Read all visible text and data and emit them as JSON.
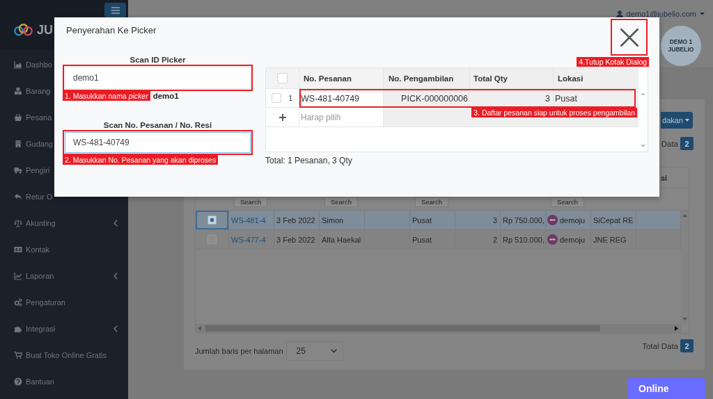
{
  "sidebar": {
    "brand": "JU",
    "items": [
      {
        "label": "Dashbo",
        "expandable": false
      },
      {
        "label": "Barang",
        "expandable": false
      },
      {
        "label": "Pesana",
        "expandable": false
      },
      {
        "label": "Gudang",
        "expandable": false
      },
      {
        "label": "Pengiri",
        "expandable": false
      },
      {
        "label": "Retur O",
        "expandable": false
      },
      {
        "label": "Akunting",
        "expandable": true
      },
      {
        "label": "Kontak",
        "expandable": false
      },
      {
        "label": "Laporan",
        "expandable": true
      },
      {
        "label": "Pengaturan",
        "expandable": false
      },
      {
        "label": "Integrasi",
        "expandable": true
      },
      {
        "label": "Buat Toko Online Gratis",
        "expandable": false
      },
      {
        "label": "Bantuan",
        "expandable": false
      }
    ]
  },
  "top_bar": {
    "user_email": "demo1@jubelio.com",
    "avatar_lines": [
      "DEMO 1",
      "JUBELIO"
    ]
  },
  "page": {
    "action_button": "dakan",
    "total": {
      "label": "Data",
      "count": "2"
    },
    "table": {
      "column_10_heading": "si",
      "filter_buttons": [
        "Search",
        "Search",
        "Search",
        "Search"
      ],
      "rows": [
        {
          "selected": true,
          "order_no": "WS-481-4",
          "date": "3 Feb 2022",
          "customer": "Simon",
          "location": "Pusat",
          "qty": "3",
          "amount": "Rp 750.000,",
          "channel": "demoju",
          "courier": "SiCepat RE"
        },
        {
          "selected": false,
          "order_no": "WS-477-4",
          "date": "3 Feb 2022",
          "customer": "Alfa Haekal",
          "location": "Pusat",
          "qty": "2",
          "amount": "Rp 510.000,",
          "channel": "demoju",
          "courier": "JNE REG"
        }
      ]
    },
    "footer": {
      "page_size_label": "Jumlah baris per halaman",
      "page_size": "25",
      "total_label": "Total Data",
      "total_count": "2"
    }
  },
  "dialog": {
    "title": "Penyerahan Ke Picker",
    "picker_field": {
      "label": "Scan ID Picker",
      "value": "demo1",
      "focused": false,
      "annotation": "1. Masukkan nama *picker*"
    },
    "picker_name": "demo1",
    "order_field": {
      "label": "Scan No. Pesanan / No. Resi",
      "value": "WS-481-40749",
      "focused": true,
      "annotation": "2. Masukkan No. Pesanan yang akan diproses"
    },
    "close_annotation": "4.Tutup Kotak Dialog",
    "table": {
      "select_all": false,
      "columns": [
        "No. Pesanan",
        "No. Pengambilan",
        "Total Qty",
        "Lokasi"
      ],
      "rows": [
        {
          "checked": false,
          "number": "1",
          "order_no": "WS-481-40749",
          "pick_no": "PICK-000000006",
          "qty": "3",
          "location": "Pusat"
        }
      ],
      "new_row_placeholder": "Harap pilih",
      "annotation": "3. Daftar pesanan siap untuk proses pengambilan"
    },
    "summary": "Total: 1 Pesanan, 3 Qty"
  },
  "chat_button": "Online"
}
